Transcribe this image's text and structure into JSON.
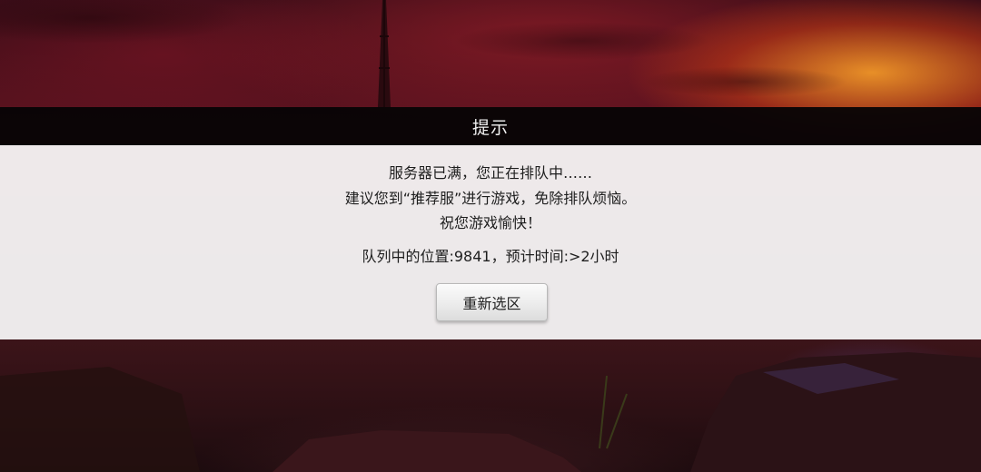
{
  "dialog": {
    "title": "提示",
    "lines": [
      "服务器已满，您正在排队中……",
      "建议您到“推荐服”进行游戏，免除排队烦恼。",
      "祝您游戏愉快！"
    ],
    "queue_info": "队列中的位置:9841，预计时间:>2小时",
    "reselect_button": "重新选区"
  },
  "colors": {
    "title_bar": "#060405",
    "panel": "#f4f3f3",
    "sky_accent": "#f09628",
    "sky_base": "#6a1522"
  }
}
